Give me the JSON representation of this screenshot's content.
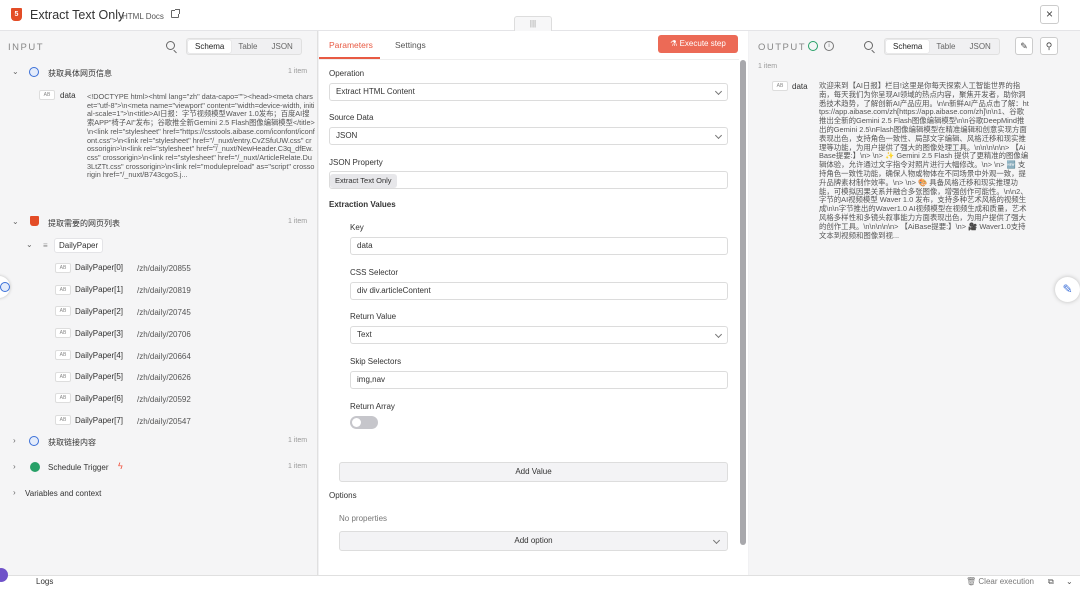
{
  "header": {
    "title": "Extract Text Only",
    "docs_link": "HTML Docs",
    "close_glyph": "×",
    "drag_glyph": "|||"
  },
  "input": {
    "heading": "INPUT",
    "view_tabs": [
      "Schema",
      "Table",
      "JSON"
    ],
    "node1": {
      "name": "获取具体网页信息",
      "count": "1 item",
      "field_type": "AB",
      "field_name": "data",
      "value": "<!DOCTYPE html><html lang=\"zh\" data-capo=\"\"><head><meta charset=\"utf-8\">\\n<meta name=\"viewport\" content=\"width=device-width, initial-scale=1\">\\n<title>AI日报：字节视频模型Waver 1.0发布；百度AI搜索APP\"椅子AI\"发布；谷歌推全新Gemini 2.5 Flash图像编辑模型</title>\\n<link rel=\"stylesheet\" href=\"https://csstools.aibase.com/iconfont/iconfont.css\">\\n<link rel=\"stylesheet\" href=\"/_nuxt/entry.CvZSfuUW.css\" crossorigin>\\n<link rel=\"stylesheet\" href=\"/_nuxt/NewHeader.C3q_dfEw.css\" crossorigin>\\n<link rel=\"stylesheet\" href=\"/_nuxt/ArticleRelate.Du3LtZTt.css\" crossorigin>\\n<link rel=\"modulepreload\" as=\"script\" crossorigin href=\"/_nuxt/B743cgoS.j..."
    },
    "node2": {
      "name": "提取需要的网页列表",
      "count": "1 item",
      "array_name": "DailyPaper",
      "items": [
        {
          "name": "DailyPaper[0]",
          "value": "/zh/daily/20855"
        },
        {
          "name": "DailyPaper[1]",
          "value": "/zh/daily/20819"
        },
        {
          "name": "DailyPaper[2]",
          "value": "/zh/daily/20745"
        },
        {
          "name": "DailyPaper[3]",
          "value": "/zh/daily/20706"
        },
        {
          "name": "DailyPaper[4]",
          "value": "/zh/daily/20664"
        },
        {
          "name": "DailyPaper[5]",
          "value": "/zh/daily/20626"
        },
        {
          "name": "DailyPaper[6]",
          "value": "/zh/daily/20592"
        },
        {
          "name": "DailyPaper[7]",
          "value": "/zh/daily/20547"
        }
      ]
    },
    "node3": {
      "name": "获取链接内容",
      "count": "1 item"
    },
    "node4": {
      "name": "Schedule Trigger",
      "count": "1 item"
    },
    "vars": "Variables and context"
  },
  "params": {
    "tabs": [
      "Parameters",
      "Settings"
    ],
    "execute_label": "Execute step",
    "operation": {
      "label": "Operation",
      "value": "Extract HTML Content"
    },
    "source_data": {
      "label": "Source Data",
      "value": "JSON"
    },
    "json_property": {
      "label": "JSON Property",
      "value": "Extract Text Only"
    },
    "extraction_values": "Extraction Values",
    "key": {
      "label": "Key",
      "value": "data"
    },
    "css_selector": {
      "label": "CSS Selector",
      "value": "div  div.articleContent"
    },
    "return_value": {
      "label": "Return Value",
      "value": "Text"
    },
    "skip_selectors": {
      "label": "Skip Selectors",
      "value": "img,nav"
    },
    "return_array": {
      "label": "Return Array"
    },
    "add_value": "Add Value",
    "options": {
      "label": "Options",
      "empty": "No properties",
      "add": "Add option"
    }
  },
  "output": {
    "heading": "OUTPUT",
    "view_tabs": [
      "Schema",
      "Table",
      "JSON"
    ],
    "count": "1 item",
    "field_type": "AB",
    "field_name": "data",
    "value": "欢迎来到【AI日报】栏目!这里是你每天探索人工智能世界的指南，每天我们为你呈现AI领域的热点内容，聚焦开发者，助你洞悉技术趋势，了解创新AI产品应用。\\n\\n新鲜AI产品点击了解：https://app.aibase.com/zh[https://app.aibase.com/zh]\\n\\n1、谷歌推出全新的Gemini 2.5 Flash图像编辑模型\\n\\n谷歌DeepMind推出的Gemini 2.5\\nFlash图像编辑模型在精准编辑和创意实现方面表现出色，支持角色一致性、局部文字编辑、风格迁移和现实推理等功能，为用户提供了强大的图像处理工具。\\n\\n\\n\\n\\n> 【AiBase提要:】\\n> \\n> ✨ Gemini 2.5 Flash 提供了更精准的图像编辑体验，允许通过文字指令对照片进行大幅修改。\\n> \\n> 🆕 支持角色一致性功能，确保人物或物体在不同场景中外观一致，提升品牌素材制作效率。\\n> \\n> 🎨 具备风格迁移和现实推理功能，可模拟因果关系并融合多张图像，增强创作可能性。\\n\\n2、字节的AI视频模型 Waver 1.0 发布，支持多种艺术风格的视频生成\\n\\n字节推出的Waver1.0 AI视频模型在视频生成和质量，艺术风格多样性和多镜头叙事能力方面表现出色，为用户提供了强大的创作工具。\\n\\n\\n\\n\\n> 【AiBase提要:】\\n> 🎥 Waver1.0支持文本到视频和图像到视..."
  },
  "footer": {
    "logs": "Logs",
    "clear": "Clear execution"
  },
  "colors": {
    "accent": "#e85a43",
    "execute_bg": "#ec6a56",
    "success": "#27a067",
    "link_blue": "#3b6fd8"
  }
}
